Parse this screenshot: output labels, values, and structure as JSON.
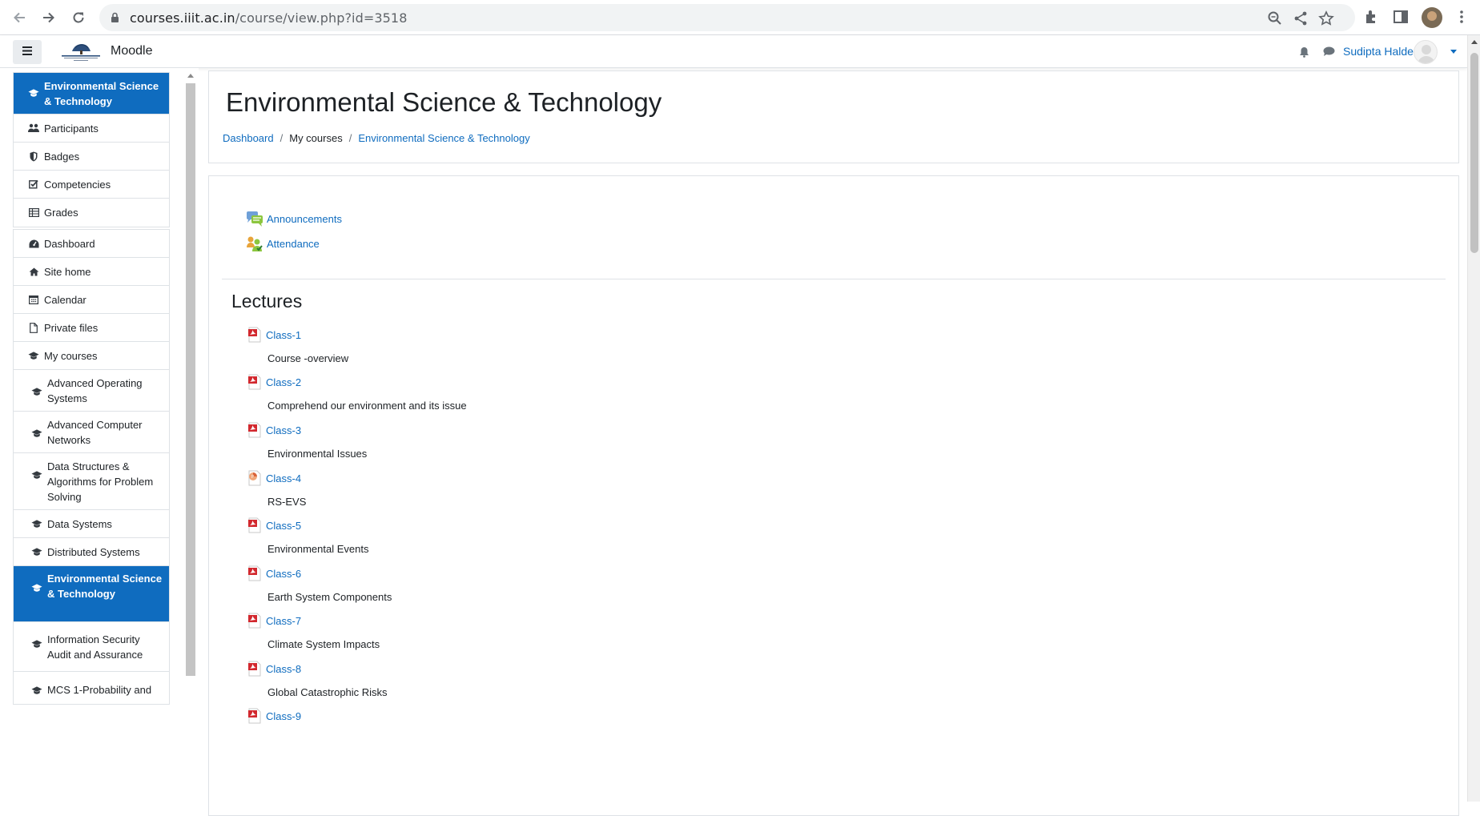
{
  "browser": {
    "url_host": "courses.iiit.ac.in",
    "url_path": "/course/view.php?id=3518"
  },
  "navbar": {
    "brand": "Moodle",
    "user_name": "Sudipta Halder"
  },
  "drawer": {
    "course_group": [
      {
        "label": "Environmental Science & Technology",
        "icon": "graduation-cap-icon",
        "active": true
      },
      {
        "label": "Participants",
        "icon": "users-icon"
      },
      {
        "label": "Badges",
        "icon": "shield-icon"
      },
      {
        "label": "Competencies",
        "icon": "check-square-icon"
      },
      {
        "label": "Grades",
        "icon": "table-icon"
      }
    ],
    "site_group": [
      {
        "label": "Dashboard",
        "icon": "dashboard-icon"
      },
      {
        "label": "Site home",
        "icon": "home-icon"
      },
      {
        "label": "Calendar",
        "icon": "calendar-icon"
      },
      {
        "label": "Private files",
        "icon": "file-icon"
      },
      {
        "label": "My courses",
        "icon": "graduation-cap-icon"
      },
      {
        "label": "Advanced Operating Systems",
        "icon": "graduation-cap-icon"
      },
      {
        "label": "Advanced Computer Networks",
        "icon": "graduation-cap-icon"
      },
      {
        "label": "Data Structures & Algorithms for Problem Solving",
        "icon": "graduation-cap-icon"
      },
      {
        "label": "Data Systems",
        "icon": "graduation-cap-icon"
      },
      {
        "label": "Distributed Systems",
        "icon": "graduation-cap-icon"
      },
      {
        "label": "Environmental Science & Technology",
        "icon": "graduation-cap-icon",
        "active": true
      },
      {
        "label": "Information Security Audit and Assurance",
        "icon": "graduation-cap-icon"
      },
      {
        "label": "MCS 1-Probability and",
        "icon": "graduation-cap-icon"
      }
    ]
  },
  "header": {
    "title": "Environmental Science & Technology",
    "breadcrumb": [
      "Dashboard",
      "My courses",
      "Environmental Science & Technology"
    ]
  },
  "general": {
    "activities": [
      {
        "label": "Announcements",
        "icon": "forum-icon"
      },
      {
        "label": "Attendance",
        "icon": "attendance-icon"
      }
    ]
  },
  "lectures": {
    "title": "Lectures",
    "items": [
      {
        "label": "Class-1",
        "desc": "Course -overview",
        "icon": "pdf-icon"
      },
      {
        "label": "Class-2",
        "desc": "Comprehend our environment and its issue",
        "icon": "pdf-icon"
      },
      {
        "label": "Class-3",
        "desc": "Environmental Issues",
        "icon": "pdf-icon"
      },
      {
        "label": "Class-4",
        "desc": "RS-EVS",
        "icon": "powerpoint-icon"
      },
      {
        "label": "Class-5",
        "desc": "Environmental Events",
        "icon": "pdf-icon"
      },
      {
        "label": "Class-6",
        "desc": "Earth System Components",
        "icon": "pdf-icon"
      },
      {
        "label": "Class-7",
        "desc": "Climate System Impacts",
        "icon": "pdf-icon"
      },
      {
        "label": "Class-8",
        "desc": "Global Catastrophic Risks",
        "icon": "pdf-icon"
      },
      {
        "label": "Class-9",
        "desc": "",
        "icon": "pdf-icon"
      }
    ]
  },
  "colors": {
    "accent": "#0f6cbf",
    "pdf_red": "#d2282e"
  }
}
